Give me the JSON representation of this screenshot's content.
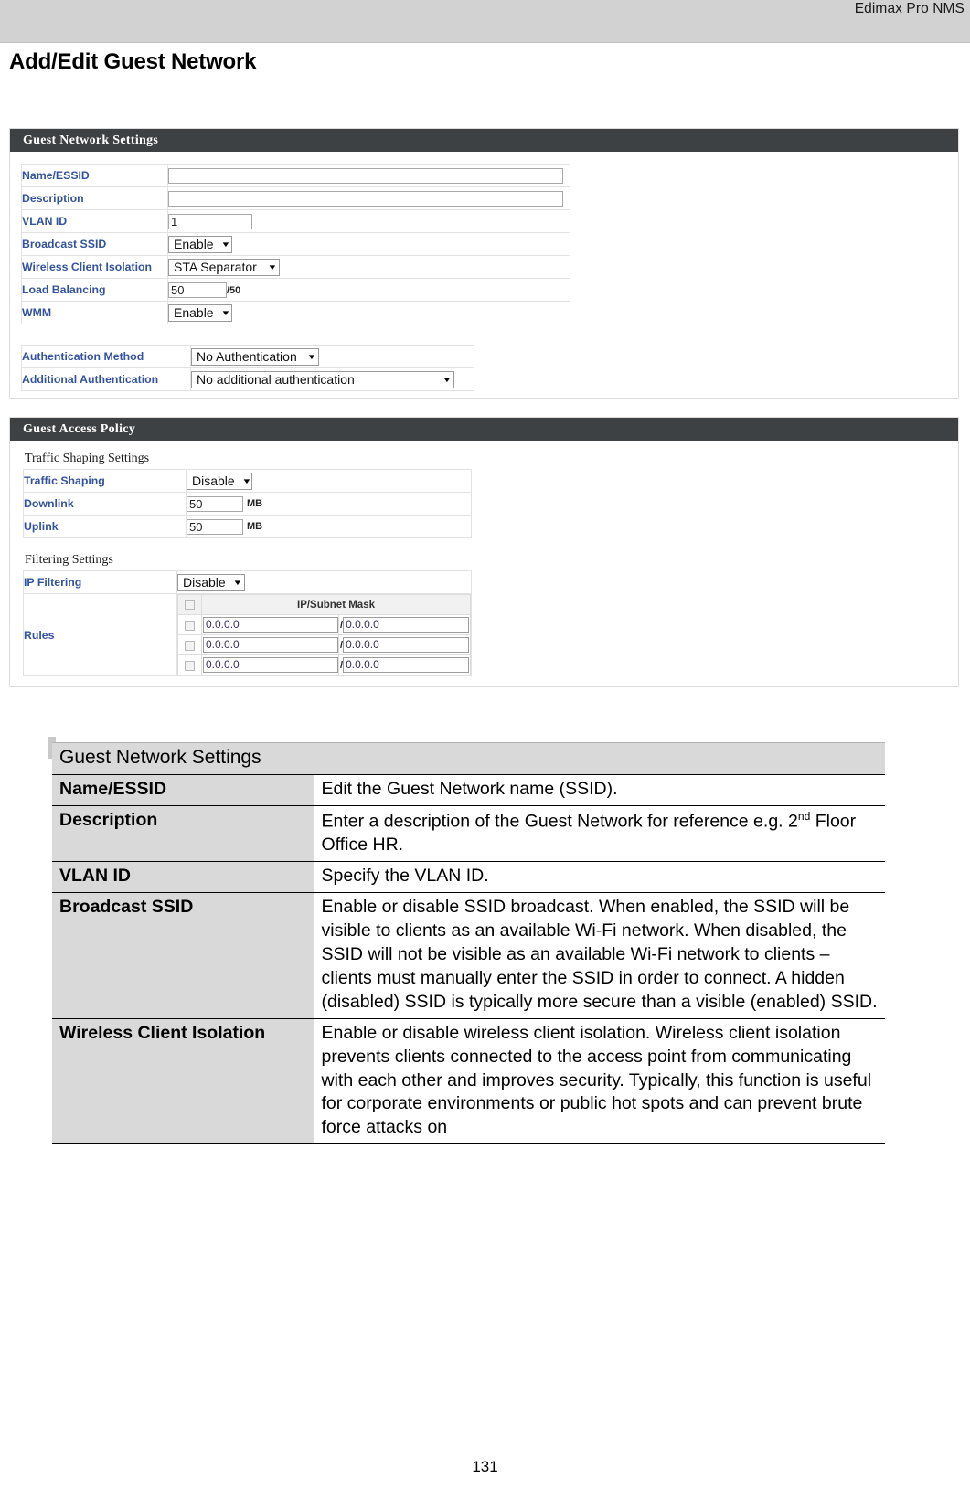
{
  "header": {
    "brand": "Edimax Pro NMS"
  },
  "title": "Add/Edit Guest Network",
  "page_number": "131",
  "screenshot": {
    "network_panel": {
      "bar_title": "Guest Network Settings",
      "rows": [
        {
          "label": "Name/ESSID",
          "type": "text",
          "value": ""
        },
        {
          "label": "Description",
          "type": "text",
          "value": ""
        },
        {
          "label": "VLAN ID",
          "type": "text",
          "value": "1"
        },
        {
          "label": "Broadcast SSID",
          "type": "select",
          "value": "Enable"
        },
        {
          "label": "Wireless Client Isolation",
          "type": "select",
          "value": "STA Separator"
        },
        {
          "label": "Load Balancing",
          "type": "text",
          "value": "50",
          "suffix": "/50"
        },
        {
          "label": "WMM",
          "type": "select",
          "value": "Enable"
        }
      ],
      "auth_rows": [
        {
          "label": "Authentication Method",
          "value": "No Authentication"
        },
        {
          "label": "Additional Authentication",
          "value": "No additional authentication"
        }
      ]
    },
    "policy_panel": {
      "bar_title": "Guest Access Policy",
      "traffic_subtitle": "Traffic Shaping Settings",
      "traffic_rows": [
        {
          "label": "Traffic Shaping",
          "type": "select",
          "value": "Disable"
        },
        {
          "label": "Downlink",
          "type": "text",
          "value": "50",
          "unit": "MB"
        },
        {
          "label": "Uplink",
          "type": "text",
          "value": "50",
          "unit": "MB"
        }
      ],
      "filtering_subtitle": "Filtering Settings",
      "ip_filtering": {
        "label": "IP Filtering",
        "value": "Disable"
      },
      "rules": {
        "label": "Rules",
        "column_header": "IP/Subnet Mask",
        "rows": [
          {
            "ip": "0.0.0.0",
            "mask": "0.0.0.0"
          },
          {
            "ip": "0.0.0.0",
            "mask": "0.0.0.0"
          },
          {
            "ip": "0.0.0.0",
            "mask": "0.0.0.0"
          }
        ]
      }
    }
  },
  "doc_table": {
    "section_header": "Guest Network Settings",
    "rows": [
      {
        "key": "Name/ESSID",
        "desc": "Edit the Guest Network name (SSID)."
      },
      {
        "key": "Description",
        "desc_pre": "Enter a description of the Guest Network for reference e.g. 2",
        "desc_sup": "nd",
        "desc_post": " Floor Office HR."
      },
      {
        "key": "VLAN ID",
        "desc": "Specify the VLAN ID."
      },
      {
        "key": "Broadcast SSID",
        "desc": "Enable or disable SSID broadcast. When enabled, the SSID will be visible to clients as an available Wi-Fi network. When disabled, the SSID will not be visible as an available Wi-Fi network to clients – clients must manually enter the SSID in order to connect. A hidden (disabled) SSID is typically more secure than a visible (enabled) SSID."
      },
      {
        "key": "Wireless Client Isolation",
        "desc": "Enable or disable wireless client isolation. Wireless client isolation prevents clients connected to the access point from communicating with each other and improves security. Typically, this function is useful for corporate environments or public hot spots and can prevent brute force attacks on"
      }
    ]
  }
}
